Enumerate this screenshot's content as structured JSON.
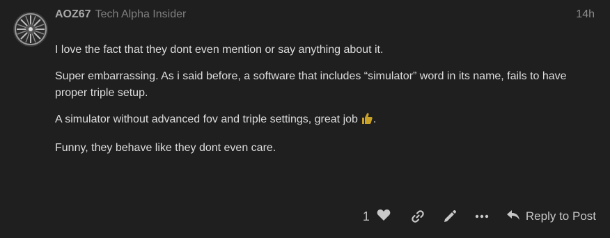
{
  "post": {
    "username": "AOZ67",
    "user_title": "Tech Alpha Insider",
    "timestamp": "14h",
    "paragraphs": [
      "I love the fact that they dont even mention or say anything about it.",
      "Super embarrassing. As i said before, a software that includes “simulator” word in its name, fails to have proper triple setup.",
      "A simulator without advanced fov and triple settings, great job",
      "Funny, they behave like they dont even care."
    ],
    "paragraph_3_suffix": "."
  },
  "actions": {
    "like_count": "1",
    "reply_label": "Reply to Post",
    "icons": [
      "heart-icon",
      "link-icon",
      "pencil-icon",
      "more-icon",
      "reply-icon"
    ]
  },
  "colors": {
    "background": "#1f1f1f",
    "text": "#dddddd",
    "muted": "#7f7f7f",
    "emoji": "#c9a227"
  }
}
